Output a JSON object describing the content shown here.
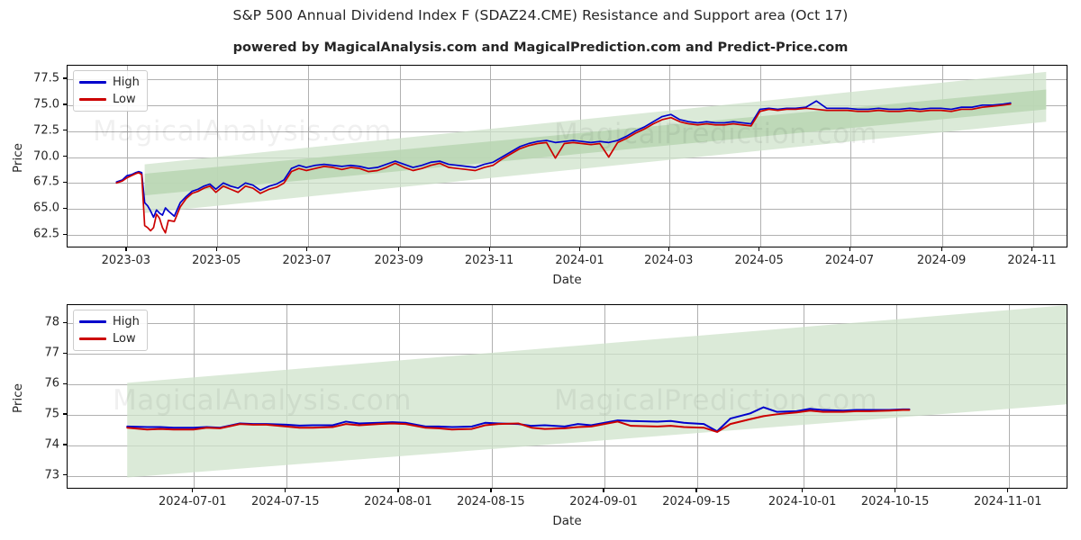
{
  "header": {
    "title": "S&P 500 Annual Dividend Index F (SDAZ24.CME) Resistance and Support area (Oct 17)",
    "subtitle": "powered by MagicalAnalysis.com and MagicalPrediction.com and Predict-Price.com"
  },
  "watermarks": [
    {
      "text": "MagicalAnalysis.com"
    },
    {
      "text": "MagicalPrediction.com"
    },
    {
      "text": "MagicalAnalysis.com"
    },
    {
      "text": "MagicalPrediction.com"
    }
  ],
  "colors": {
    "high": "#0000cc",
    "low": "#cc0000",
    "band_outer": "#cfe3cb",
    "band_inner": "#b9d6b3",
    "grid": "#b0b0b0",
    "axis": "#000000",
    "text": "#262626"
  },
  "legend": {
    "items": [
      {
        "label": "High",
        "color": "#0000cc"
      },
      {
        "label": "Low",
        "color": "#cc0000"
      }
    ]
  },
  "chart_data": [
    {
      "id": "overview",
      "type": "line",
      "title": "S&P 500 Annual Dividend Index F (SDAZ24.CME) Resistance and Support area (Oct 17)",
      "xlabel": "Date",
      "ylabel": "Price",
      "grid": true,
      "legend_position": "upper left",
      "ylim": [
        61.2,
        78.8
      ],
      "yticks": [
        62.5,
        65.0,
        67.5,
        70.0,
        72.5,
        75.0,
        77.5
      ],
      "ytick_labels": [
        "62.5",
        "65.0",
        "67.5",
        "70.0",
        "72.5",
        "75.0",
        "77.5"
      ],
      "xlim": [
        "2023-01-20",
        "2024-11-25"
      ],
      "xticks": [
        "2023-03",
        "2023-05",
        "2023-07",
        "2023-09",
        "2023-11",
        "2024-01",
        "2024-03",
        "2024-05",
        "2024-07",
        "2024-09",
        "2024-11"
      ],
      "series": [
        {
          "name": "High",
          "color": "#0000cc",
          "x": [
            "2023-02-22",
            "2023-02-26",
            "2023-03-01",
            "2023-03-04",
            "2023-03-07",
            "2023-03-09",
            "2023-03-11",
            "2023-03-13",
            "2023-03-15",
            "2023-03-17",
            "2023-03-19",
            "2023-03-21",
            "2023-03-23",
            "2023-03-25",
            "2023-03-27",
            "2023-03-29",
            "2023-04-02",
            "2023-04-06",
            "2023-04-10",
            "2023-04-14",
            "2023-04-18",
            "2023-04-22",
            "2023-04-26",
            "2023-04-30",
            "2023-05-05",
            "2023-05-10",
            "2023-05-15",
            "2023-05-20",
            "2023-05-25",
            "2023-05-30",
            "2023-06-05",
            "2023-06-10",
            "2023-06-15",
            "2023-06-20",
            "2023-06-25",
            "2023-06-30",
            "2023-07-06",
            "2023-07-12",
            "2023-07-18",
            "2023-07-24",
            "2023-07-30",
            "2023-08-05",
            "2023-08-11",
            "2023-08-17",
            "2023-08-23",
            "2023-08-29",
            "2023-09-04",
            "2023-09-10",
            "2023-09-16",
            "2023-09-22",
            "2023-09-28",
            "2023-10-04",
            "2023-10-10",
            "2023-10-16",
            "2023-10-22",
            "2023-10-28",
            "2023-11-03",
            "2023-11-09",
            "2023-11-15",
            "2023-11-21",
            "2023-11-27",
            "2023-12-03",
            "2023-12-09",
            "2023-12-15",
            "2023-12-21",
            "2023-12-27",
            "2024-01-02",
            "2024-01-08",
            "2024-01-14",
            "2024-01-20",
            "2024-01-26",
            "2024-02-01",
            "2024-02-07",
            "2024-02-13",
            "2024-02-19",
            "2024-02-25",
            "2024-03-02",
            "2024-03-08",
            "2024-03-14",
            "2024-03-20",
            "2024-03-26",
            "2024-04-01",
            "2024-04-07",
            "2024-04-13",
            "2024-04-19",
            "2024-04-25",
            "2024-05-01",
            "2024-05-07",
            "2024-05-13",
            "2024-05-19",
            "2024-05-25",
            "2024-06-01",
            "2024-06-08",
            "2024-06-15",
            "2024-06-22",
            "2024-06-29",
            "2024-07-06",
            "2024-07-13",
            "2024-07-20",
            "2024-07-27",
            "2024-08-03",
            "2024-08-10",
            "2024-08-17",
            "2024-08-24",
            "2024-08-31",
            "2024-09-07",
            "2024-09-14",
            "2024-09-21",
            "2024-09-28",
            "2024-10-05",
            "2024-10-12",
            "2024-10-17"
          ],
          "y": [
            67.6,
            67.8,
            68.2,
            68.3,
            68.5,
            68.6,
            68.5,
            65.6,
            65.3,
            64.8,
            64.2,
            64.9,
            64.6,
            64.4,
            65.1,
            64.8,
            64.3,
            65.6,
            66.2,
            66.7,
            66.9,
            67.2,
            67.4,
            66.9,
            67.5,
            67.2,
            67.0,
            67.5,
            67.3,
            66.8,
            67.2,
            67.4,
            67.8,
            68.9,
            69.2,
            69.0,
            69.2,
            69.3,
            69.2,
            69.1,
            69.2,
            69.1,
            68.9,
            69.0,
            69.3,
            69.6,
            69.3,
            69.0,
            69.2,
            69.5,
            69.6,
            69.3,
            69.2,
            69.1,
            69.0,
            69.3,
            69.5,
            70.0,
            70.5,
            71.0,
            71.3,
            71.5,
            71.6,
            71.4,
            71.5,
            71.6,
            71.5,
            71.4,
            71.5,
            71.4,
            71.6,
            72.0,
            72.5,
            72.9,
            73.4,
            73.9,
            74.1,
            73.6,
            73.4,
            73.3,
            73.4,
            73.3,
            73.3,
            73.4,
            73.3,
            73.2,
            74.6,
            74.7,
            74.6,
            74.7,
            74.7,
            74.8,
            75.4,
            74.7,
            74.7,
            74.7,
            74.6,
            74.6,
            74.7,
            74.6,
            74.6,
            74.7,
            74.6,
            74.7,
            74.7,
            74.6,
            74.8,
            74.8,
            75.0,
            75.0,
            75.1,
            75.2
          ]
        },
        {
          "name": "Low",
          "color": "#cc0000",
          "x": [
            "2023-02-22",
            "2023-02-26",
            "2023-03-01",
            "2023-03-04",
            "2023-03-07",
            "2023-03-09",
            "2023-03-11",
            "2023-03-13",
            "2023-03-15",
            "2023-03-17",
            "2023-03-19",
            "2023-03-21",
            "2023-03-23",
            "2023-03-25",
            "2023-03-27",
            "2023-03-29",
            "2023-04-02",
            "2023-04-06",
            "2023-04-10",
            "2023-04-14",
            "2023-04-18",
            "2023-04-22",
            "2023-04-26",
            "2023-04-30",
            "2023-05-05",
            "2023-05-10",
            "2023-05-15",
            "2023-05-20",
            "2023-05-25",
            "2023-05-30",
            "2023-06-05",
            "2023-06-10",
            "2023-06-15",
            "2023-06-20",
            "2023-06-25",
            "2023-06-30",
            "2023-07-06",
            "2023-07-12",
            "2023-07-18",
            "2023-07-24",
            "2023-07-30",
            "2023-08-05",
            "2023-08-11",
            "2023-08-17",
            "2023-08-23",
            "2023-08-29",
            "2023-09-04",
            "2023-09-10",
            "2023-09-16",
            "2023-09-22",
            "2023-09-28",
            "2023-10-04",
            "2023-10-10",
            "2023-10-16",
            "2023-10-22",
            "2023-10-28",
            "2023-11-03",
            "2023-11-09",
            "2023-11-15",
            "2023-11-21",
            "2023-11-27",
            "2023-12-03",
            "2023-12-09",
            "2023-12-15",
            "2023-12-21",
            "2023-12-27",
            "2024-01-02",
            "2024-01-08",
            "2024-01-14",
            "2024-01-20",
            "2024-01-26",
            "2024-02-01",
            "2024-02-07",
            "2024-02-13",
            "2024-02-19",
            "2024-02-25",
            "2024-03-02",
            "2024-03-08",
            "2024-03-14",
            "2024-03-20",
            "2024-03-26",
            "2024-04-01",
            "2024-04-07",
            "2024-04-13",
            "2024-04-19",
            "2024-04-25",
            "2024-05-01",
            "2024-05-07",
            "2024-05-13",
            "2024-05-19",
            "2024-05-25",
            "2024-06-01",
            "2024-06-08",
            "2024-06-15",
            "2024-06-22",
            "2024-06-29",
            "2024-07-06",
            "2024-07-13",
            "2024-07-20",
            "2024-07-27",
            "2024-08-03",
            "2024-08-10",
            "2024-08-17",
            "2024-08-24",
            "2024-08-31",
            "2024-09-07",
            "2024-09-14",
            "2024-09-21",
            "2024-09-28",
            "2024-10-05",
            "2024-10-12",
            "2024-10-17"
          ],
          "y": [
            67.5,
            67.7,
            68.0,
            68.2,
            68.4,
            68.5,
            68.3,
            63.4,
            63.2,
            62.9,
            63.2,
            64.5,
            64.1,
            63.2,
            62.7,
            63.9,
            63.8,
            65.2,
            66.0,
            66.5,
            66.7,
            67.0,
            67.2,
            66.6,
            67.2,
            66.9,
            66.6,
            67.2,
            67.0,
            66.5,
            66.9,
            67.1,
            67.5,
            68.6,
            68.9,
            68.7,
            68.9,
            69.1,
            69.0,
            68.8,
            69.0,
            68.9,
            68.6,
            68.7,
            69.0,
            69.4,
            69.0,
            68.7,
            68.9,
            69.2,
            69.4,
            69.0,
            68.9,
            68.8,
            68.7,
            69.0,
            69.2,
            69.8,
            70.3,
            70.8,
            71.1,
            71.3,
            71.4,
            69.9,
            71.3,
            71.4,
            71.3,
            71.2,
            71.3,
            70.0,
            71.4,
            71.8,
            72.3,
            72.7,
            73.2,
            73.6,
            73.8,
            73.4,
            73.2,
            73.1,
            73.2,
            73.1,
            73.1,
            73.2,
            73.1,
            73.0,
            74.4,
            74.6,
            74.5,
            74.6,
            74.6,
            74.7,
            74.6,
            74.5,
            74.5,
            74.5,
            74.4,
            74.4,
            74.5,
            74.4,
            74.4,
            74.5,
            74.4,
            74.5,
            74.5,
            74.4,
            74.6,
            74.6,
            74.8,
            74.9,
            75.0,
            75.1
          ]
        }
      ],
      "bands": [
        {
          "name": "outer-resistance-support-area",
          "color": "#cfe3cb",
          "opacity": 0.75,
          "x_start": "2023-03-13",
          "x_end": "2024-11-10",
          "y_start_top": 69.3,
          "y_start_bottom": 64.6,
          "y_end_top": 78.2,
          "y_end_bottom": 73.4
        },
        {
          "name": "inner-resistance-support-area",
          "color": "#b9d6b3",
          "opacity": 0.85,
          "x_start": "2023-03-13",
          "x_end": "2024-11-10",
          "y_start_top": 68.4,
          "y_start_bottom": 66.3,
          "y_end_top": 76.5,
          "y_end_bottom": 74.6
        }
      ]
    },
    {
      "id": "zoom",
      "type": "line",
      "xlabel": "Date",
      "ylabel": "Price",
      "grid": true,
      "legend_position": "upper left",
      "ylim": [
        72.55,
        78.6
      ],
      "yticks": [
        73,
        74,
        75,
        76,
        77,
        78
      ],
      "ytick_labels": [
        "73",
        "74",
        "75",
        "76",
        "77",
        "78"
      ],
      "xlim": [
        "2024-06-12",
        "2024-11-10"
      ],
      "xticks": [
        "2024-07-01",
        "2024-07-15",
        "2024-08-01",
        "2024-08-15",
        "2024-09-01",
        "2024-09-15",
        "2024-10-01",
        "2024-10-15",
        "2024-11-01"
      ],
      "series": [
        {
          "name": "High",
          "color": "#0000cc",
          "x": [
            "2024-06-21",
            "2024-06-24",
            "2024-06-26",
            "2024-06-28",
            "2024-07-01",
            "2024-07-03",
            "2024-07-05",
            "2024-07-08",
            "2024-07-10",
            "2024-07-12",
            "2024-07-15",
            "2024-07-17",
            "2024-07-19",
            "2024-07-22",
            "2024-07-24",
            "2024-07-26",
            "2024-07-29",
            "2024-07-31",
            "2024-08-02",
            "2024-08-05",
            "2024-08-07",
            "2024-08-09",
            "2024-08-12",
            "2024-08-14",
            "2024-08-16",
            "2024-08-19",
            "2024-08-21",
            "2024-08-23",
            "2024-08-26",
            "2024-08-28",
            "2024-08-30",
            "2024-09-03",
            "2024-09-05",
            "2024-09-09",
            "2024-09-11",
            "2024-09-13",
            "2024-09-16",
            "2024-09-18",
            "2024-09-20",
            "2024-09-23",
            "2024-09-25",
            "2024-09-27",
            "2024-09-30",
            "2024-10-02",
            "2024-10-04",
            "2024-10-07",
            "2024-10-09",
            "2024-10-11",
            "2024-10-14",
            "2024-10-16",
            "2024-10-17"
          ],
          "y": [
            74.62,
            74.6,
            74.6,
            74.58,
            74.58,
            74.6,
            74.58,
            74.72,
            74.7,
            74.7,
            74.68,
            74.65,
            74.66,
            74.66,
            74.78,
            74.72,
            74.74,
            74.76,
            74.74,
            74.62,
            74.62,
            74.6,
            74.62,
            74.74,
            74.72,
            74.7,
            74.64,
            74.66,
            74.62,
            74.7,
            74.66,
            74.82,
            74.8,
            74.78,
            74.8,
            74.74,
            74.7,
            74.46,
            74.88,
            75.05,
            75.25,
            75.1,
            75.12,
            75.2,
            75.16,
            75.14,
            75.16,
            75.16,
            75.16,
            75.18,
            75.18
          ]
        },
        {
          "name": "Low",
          "color": "#cc0000",
          "x": [
            "2024-06-21",
            "2024-06-24",
            "2024-06-26",
            "2024-06-28",
            "2024-07-01",
            "2024-07-03",
            "2024-07-05",
            "2024-07-08",
            "2024-07-10",
            "2024-07-12",
            "2024-07-15",
            "2024-07-17",
            "2024-07-19",
            "2024-07-22",
            "2024-07-24",
            "2024-07-26",
            "2024-07-29",
            "2024-07-31",
            "2024-08-02",
            "2024-08-05",
            "2024-08-07",
            "2024-08-09",
            "2024-08-12",
            "2024-08-14",
            "2024-08-16",
            "2024-08-19",
            "2024-08-21",
            "2024-08-23",
            "2024-08-26",
            "2024-08-28",
            "2024-08-30",
            "2024-09-03",
            "2024-09-05",
            "2024-09-09",
            "2024-09-11",
            "2024-09-13",
            "2024-09-16",
            "2024-09-18",
            "2024-09-20",
            "2024-09-23",
            "2024-09-25",
            "2024-09-27",
            "2024-09-30",
            "2024-10-02",
            "2024-10-04",
            "2024-10-07",
            "2024-10-09",
            "2024-10-11",
            "2024-10-14",
            "2024-10-16",
            "2024-10-17"
          ],
          "y": [
            74.58,
            74.52,
            74.54,
            74.52,
            74.52,
            74.58,
            74.56,
            74.7,
            74.68,
            74.68,
            74.62,
            74.58,
            74.58,
            74.6,
            74.7,
            74.66,
            74.7,
            74.72,
            74.7,
            74.58,
            74.56,
            74.52,
            74.54,
            74.66,
            74.7,
            74.72,
            74.58,
            74.54,
            74.56,
            74.6,
            74.62,
            74.78,
            74.64,
            74.62,
            74.64,
            74.6,
            74.58,
            74.44,
            74.7,
            74.86,
            74.96,
            75.02,
            75.08,
            75.14,
            75.1,
            75.1,
            75.12,
            75.12,
            75.14,
            75.16,
            75.16
          ]
        }
      ],
      "bands": [
        {
          "name": "outer-resistance-support-area",
          "color": "#cfe3cb",
          "opacity": 0.75,
          "x_start": "2024-06-21",
          "x_end": "2024-11-10",
          "y_start_top": 76.05,
          "y_start_bottom": 72.95,
          "y_end_top": 78.6,
          "y_end_bottom": 75.35
        },
        {
          "name": "inner-resistance-support-area",
          "color": "#b9d6b3",
          "opacity": 0.0,
          "x_start": "2024-06-21",
          "x_end": "2024-11-10",
          "y_start_top": 76.05,
          "y_start_bottom": 74.55,
          "y_end_top": 78.6,
          "y_end_bottom": 75.35
        }
      ]
    }
  ]
}
